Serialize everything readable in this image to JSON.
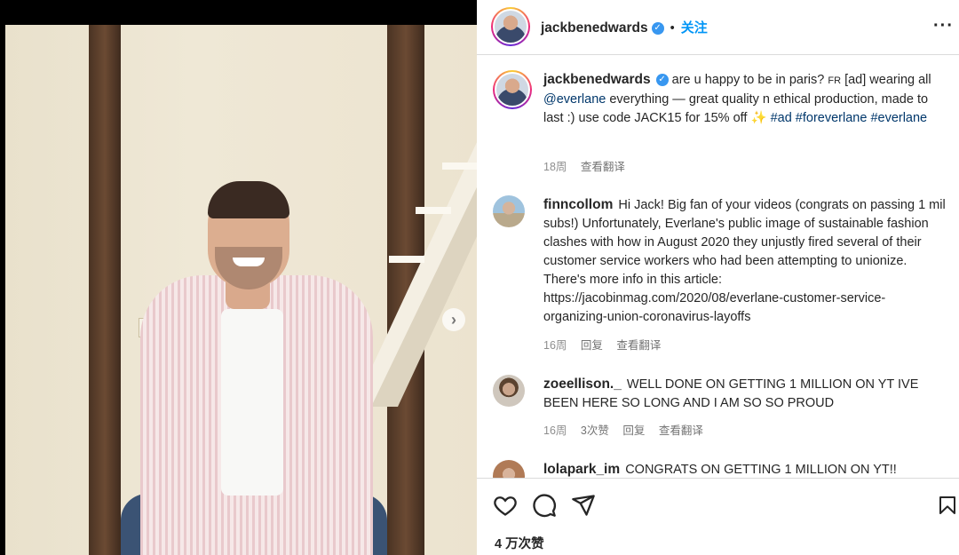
{
  "post": {
    "username": "jackbenedwards",
    "follow_label": "关注",
    "dot": "•",
    "more": "•••"
  },
  "caption": {
    "username": "jackbenedwards",
    "text_1": "are u happy to be in paris? ",
    "flag": "FR",
    "text_2": " [ad] wearing all ",
    "mention": "@everlane",
    "text_3": " everything — great quality n ethical production, made to last :) use code JACK15 for 15% off ✨ ",
    "hashtags": [
      "#ad",
      "#foreverlane",
      "#everlane"
    ],
    "time": "18周",
    "translate": "查看翻译"
  },
  "comments": [
    {
      "username": "finncollom",
      "text": "Hi Jack! Big fan of your videos (congrats on passing 1 mil subs!) Unfortunately, Everlane's public image of sustainable fashion clashes with how in August 2020 they unjustly fired several of their customer service workers who had been attempting to unionize. There's more info in this article: https://jacobinmag.com/2020/08/everlane-customer-service-organizing-union-coronavirus-layoffs",
      "time": "16周",
      "reply": "回复",
      "translate": "查看翻译"
    },
    {
      "username": "zoeellison._",
      "text": "WELL DONE ON GETTING 1 MILLION ON YT IVE BEEN HERE SO LONG AND I AM SO SO PROUD",
      "time": "16周",
      "likes": "3次赞",
      "reply": "回复",
      "translate": "查看翻译"
    },
    {
      "username": "lolapark_im",
      "text": "CONGRATS ON GETTING 1 MILLION ON YT!!"
    }
  ],
  "likes_count": "4 万次赞",
  "colors": {
    "link": "#00376b",
    "follow": "#0095f6",
    "meta": "#8e8e8e",
    "verified": "#3897f0"
  },
  "icons": [
    "heart-icon",
    "comment-icon",
    "share-icon",
    "bookmark-icon",
    "chevron-right-icon",
    "verified-icon",
    "more-icon"
  ]
}
